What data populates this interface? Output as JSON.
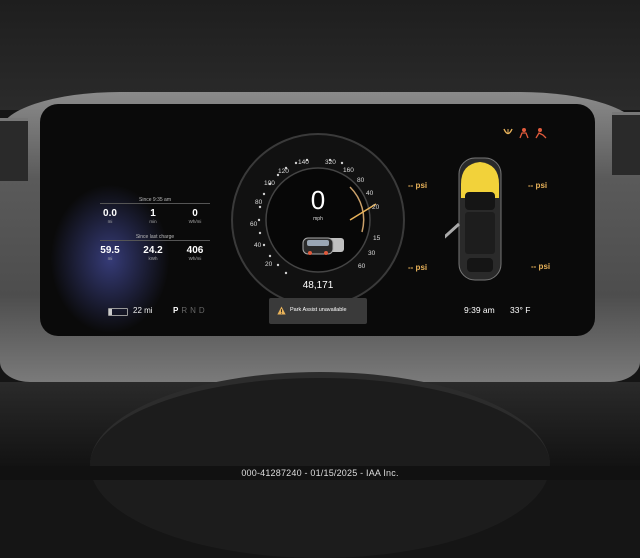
{
  "trip": {
    "since_time_label": "Since 9:35 am",
    "since_time_stats": [
      {
        "value": "0.0",
        "unit": "mi"
      },
      {
        "value": "1",
        "unit": "min"
      },
      {
        "value": "0",
        "unit": "Wh/mi"
      }
    ],
    "since_charge_label": "Since last charge",
    "since_charge_stats": [
      {
        "value": "59.5",
        "unit": "mi"
      },
      {
        "value": "24.2",
        "unit": "kWh"
      },
      {
        "value": "406",
        "unit": "Wh/mi"
      }
    ]
  },
  "range": "22 mi",
  "gears": {
    "p": "P",
    "r": "R",
    "n": "N",
    "d": "D",
    "selected": "P"
  },
  "speedometer": {
    "speed": "0",
    "unit": "mph",
    "odometer": "48,171",
    "ticks_left": [
      "140",
      "120",
      "100",
      "80",
      "60",
      "40",
      "20"
    ],
    "ticks_right": [
      "320",
      "160",
      "80",
      "40",
      "20",
      "15",
      "30",
      "60"
    ]
  },
  "alert": {
    "text": "Park Assist unavailable",
    "icon": "warning-triangle-icon"
  },
  "tires": {
    "fl": "-- psi",
    "fr": "-- psi",
    "rl": "-- psi",
    "rr": "-- psi"
  },
  "clock": "9:39 am",
  "outside_temp": "33° F",
  "status_icons": [
    "tpms-warning-icon",
    "seatbelt-warning-icon",
    "airbag-warning-icon"
  ],
  "colors": {
    "accent_amber": "#e9b35a",
    "warning_red": "#e05a3c",
    "car_yellow": "#f2d23a"
  },
  "footer": "000-41287240 - 01/15/2025 - IAA Inc."
}
